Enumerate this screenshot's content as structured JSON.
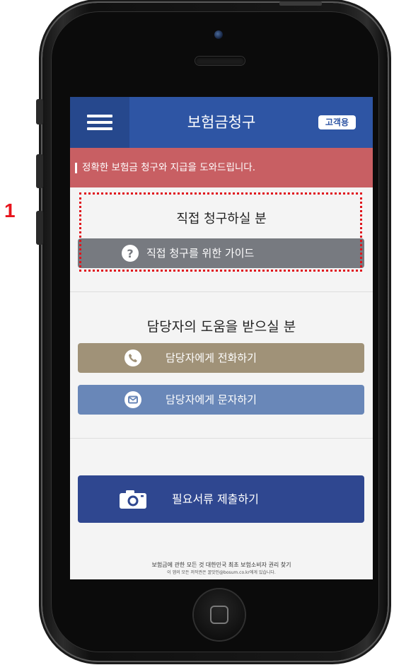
{
  "annotation": {
    "step_number": "1"
  },
  "header": {
    "title": "보험금청구",
    "badge": "고객용"
  },
  "banner": {
    "text": "정확한 보험금 청구와 지급을 도와드립니다."
  },
  "section_direct": {
    "title": "직접 청구하실 분",
    "guide_button": "직접 청구를 위한 가이드"
  },
  "section_agent": {
    "title": "담당자의 도움을 받으실 분",
    "call_button": "담당자에게 전화하기",
    "sms_button": "담당자에게 문자하기"
  },
  "submit": {
    "label": "필요서류 제출하기"
  },
  "footer": {
    "line1": "보험금에 관한 모든 것 대한민국 최초 보험소비자 권리 찾기",
    "line2": "이 앱의 모든 저작권은 꿀맛인@bosum.co.kr에게 있습니다."
  },
  "colors": {
    "header": "#2e55a4",
    "banner": "#c85f63",
    "guide": "#777a80",
    "call": "#a09278",
    "sms": "#6987b8",
    "submit": "#2f4790",
    "highlight": "#e0141c"
  },
  "icons": [
    "menu-icon",
    "question-icon",
    "phone-icon",
    "mail-icon",
    "camera-icon"
  ]
}
